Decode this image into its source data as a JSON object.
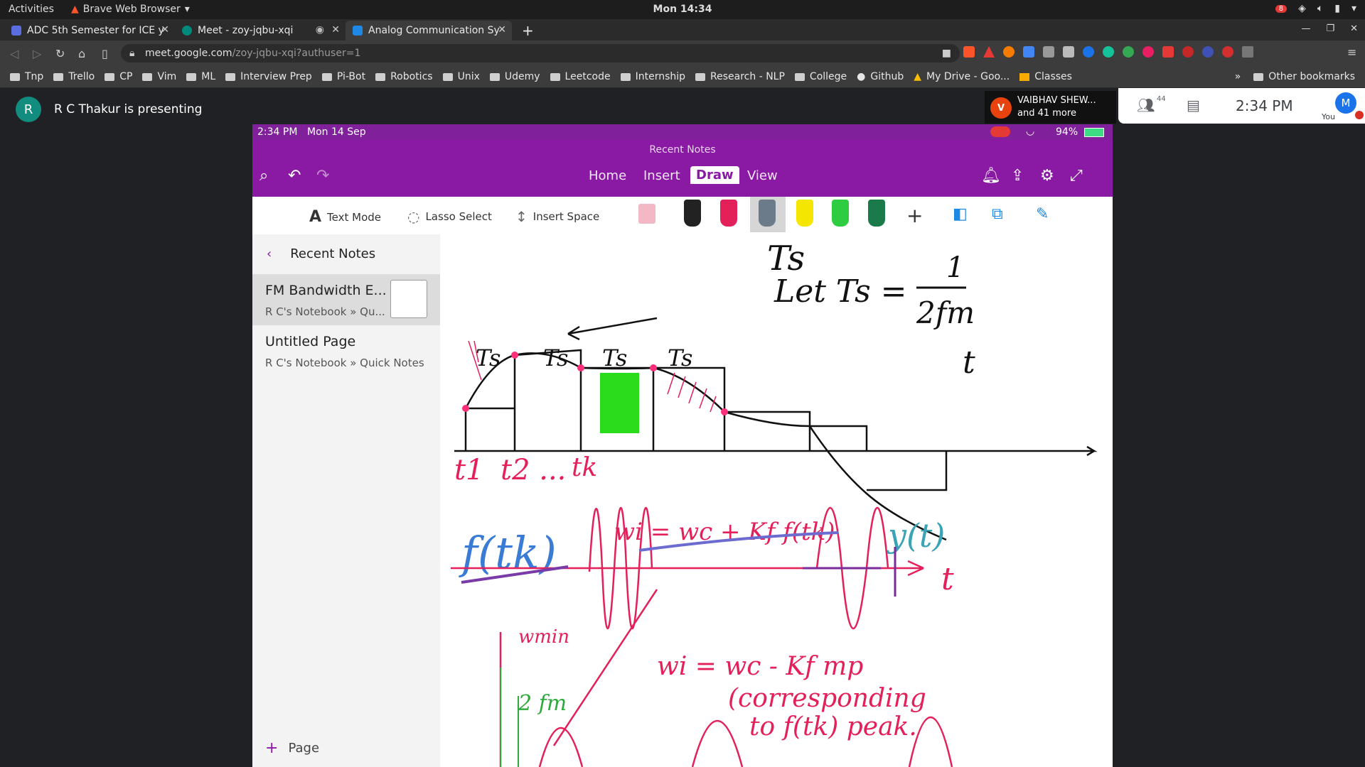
{
  "gnome": {
    "activities": "Activities",
    "app_menu": "Brave Web Browser",
    "clock": "Mon 14:34",
    "notification_count": "8"
  },
  "browser": {
    "tabs": [
      {
        "label": "ADC 5th Semester for ICE y",
        "active": false
      },
      {
        "label": "Meet - zoy-jqbu-xqi",
        "active": false
      },
      {
        "label": "Analog Communication Sy",
        "active": true
      }
    ],
    "url_host": "meet.google.com",
    "url_path": "/zoy-jqbu-xqi?authuser=1",
    "bookmarks": [
      "Tnp",
      "Trello",
      "CP",
      "Vim",
      "ML",
      "Interview Prep",
      "Pi-Bot",
      "Robotics",
      "Unix",
      "Udemy",
      "Leetcode",
      "Internship",
      "Research - NLP",
      "College",
      "Github",
      "My Drive - Goo...",
      "Classes"
    ],
    "other_bookmarks": "Other bookmarks",
    "overflow": "»"
  },
  "meet": {
    "presenter_initial": "R",
    "presenter_text": "R C Thakur is presenting",
    "participant_initial": "V",
    "participant_name": "VAIBHAV SHEW...",
    "participant_more": "and 41 more",
    "people_count": "44",
    "time": "2:34 PM",
    "you_initial": "M",
    "you_label": "You"
  },
  "ipad": {
    "status_time": "2:34 PM",
    "status_date": "Mon 14 Sep",
    "battery": "94%",
    "header_subtitle": "Recent Notes",
    "ribbon_tabs": [
      "Home",
      "Insert",
      "Draw",
      "View"
    ],
    "tools": {
      "text_mode": "Text Mode",
      "lasso_select": "Lasso Select",
      "insert_space": "Insert Space"
    },
    "pen_colors": [
      "#222222",
      "#e2205a",
      "#6b7b8a",
      "#f5e600",
      "#2ecc40",
      "#1a7a4a"
    ],
    "sidebar": {
      "title": "Recent Notes",
      "notes": [
        {
          "title": "FM Bandwidth E...",
          "path": "R C's Notebook » Qu...",
          "selected": true
        },
        {
          "title": "Untitled Page",
          "path": "R C's Notebook » Quick Notes",
          "selected": false
        }
      ],
      "add_page": "Page"
    },
    "ink": {
      "ts": "Ts",
      "let_ts": "Let Ts =",
      "one": "1",
      "two_fm": "2fm",
      "t_axis": "t",
      "t1": "t1",
      "t2": "t2 ...",
      "tk": "tk",
      "f_tk": "f(tk)",
      "wi_eq": "wi = wc + Kf f(tk)",
      "y_t": "y(t)",
      "w_min": "wmin",
      "two_fm_low": "2 fm",
      "wi_min_eq": "wi = wc - Kf mp",
      "corresponding": "(corresponding",
      "to_peak": "to f(tk) peak."
    }
  }
}
